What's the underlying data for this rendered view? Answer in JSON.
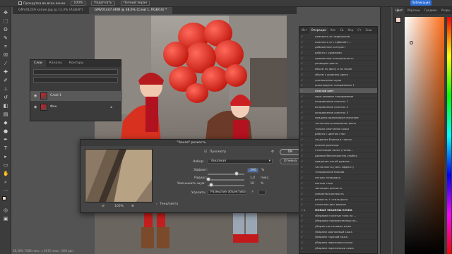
{
  "options_bar": {
    "scroll_all": "Прокрутка во всех окнах",
    "zoom": "100%",
    "fit_screen": "Подогнать",
    "full_screen": "Полный экран",
    "publish": "Публикация"
  },
  "doc_tabs": [
    {
      "label": "GMV01249 копия.jpg @ 13,3% (RGB/8*)",
      "active": false
    },
    {
      "label": "GMV01447.ARW @ 38,6% (Слой 1, RGB/16) *",
      "active": true
    }
  ],
  "status_bar": {
    "zoom": "38,58%",
    "info": "7008 пикс. x 4672 пикс. (300 ppi)"
  },
  "layers_panel": {
    "tabs": [
      "Слои",
      "Каналы",
      "Контуры"
    ],
    "layers": [
      {
        "name": "Слой 1",
        "selected": true
      },
      {
        "name": "Фон",
        "selected": false
      }
    ]
  },
  "smart_sharpen": {
    "title": "\"Умная\" резкость",
    "preview_label": "Просмотр",
    "ok": "ОК",
    "cancel": "Отмена",
    "preset_label": "Набор:",
    "preset_value": "Заказная",
    "amount_label": "Эффект:",
    "amount_value": "390",
    "amount_unit": "%",
    "amount_fraction": 0.78,
    "radius_label": "Радиус:",
    "radius_value": "1,0",
    "radius_unit": "пикс.",
    "radius_fraction": 0.02,
    "noise_label": "Уменьшить шум:",
    "noise_value": "10",
    "noise_unit": "%",
    "noise_fraction": 0.1,
    "remove_label": "Удалить:",
    "remove_value": "Размытие объектива",
    "zoom_value": "100%",
    "shadows_label": "Тени/света"
  },
  "history_panel": {
    "tabs": [
      "Ист",
      "Операции",
      "Кис",
      "Св",
      "Кор",
      "Ст",
      "Экш"
    ],
    "items": [
      {
        "label": "изменить от терракотов",
        "type": "item"
      },
      {
        "label": "изменить от глубокой т...",
        "type": "item"
      },
      {
        "label": "добавление контраст",
        "type": "item"
      },
      {
        "label": "работа с уровнями",
        "type": "item"
      },
      {
        "label": "правильное насыщенность",
        "type": "item"
      },
      {
        "label": "разводим цвета",
        "type": "item"
      },
      {
        "label": "объем по фону и на герое",
        "type": "item"
      },
      {
        "label": "объем с уровнем цвета",
        "type": "item"
      },
      {
        "label": "уменьшение шума",
        "type": "item"
      },
      {
        "label": "шоколадное тонирование 1",
        "type": "item"
      },
      {
        "label": "нежный цвет",
        "type": "selected"
      },
      {
        "label": "серо-лиловое тонирование",
        "type": "item"
      },
      {
        "label": "исправление синеток 1",
        "type": "item"
      },
      {
        "label": "исправление синеток 2",
        "type": "item"
      },
      {
        "label": "исправление синеток 3",
        "type": "item"
      },
      {
        "label": "придаем оранжевым свечение",
        "type": "item"
      },
      {
        "label": "частичное размывание фона",
        "type": "item"
      },
      {
        "label": "тонкая смягчение кожи",
        "type": "item"
      },
      {
        "label": "работа с цветом глаз",
        "type": "item"
      },
      {
        "label": "создание бликов в глазах",
        "type": "item"
      },
      {
        "label": "красим румянцы",
        "type": "item"
      },
      {
        "label": "стилизация волос (тонир...",
        "type": "item"
      },
      {
        "label": "дамаем безопложную улыбку",
        "type": "item"
      },
      {
        "label": "придание пятой румяне...",
        "type": "item"
      },
      {
        "label": "частичность (чекс эффект)",
        "type": "item"
      },
      {
        "label": "тонирование бликов",
        "type": "item"
      },
      {
        "label": "легкая тонировка",
        "type": "item"
      },
      {
        "label": "мягкие тени",
        "type": "item"
      },
      {
        "label": "звенящая резкость",
        "type": "item"
      },
      {
        "label": "умеренная резкость",
        "type": "item"
      },
      {
        "label": "резкость + стиль фото",
        "type": "item"
      },
      {
        "label": "сложные цвет веркие",
        "type": "item"
      },
      {
        "label": "НОВЫЕ ЭКШЕНЫ КОЖА",
        "type": "set"
      },
      {
        "label": "уберааем грязные тона на ...",
        "type": "item"
      },
      {
        "label": "уберааем пересвеченную по...",
        "type": "item"
      },
      {
        "label": "уберем синтоновые кожа",
        "type": "item"
      },
      {
        "label": "убираем оранжевый кожа",
        "type": "item"
      },
      {
        "label": "убираем горячий кожа",
        "type": "item"
      },
      {
        "label": "убираем переналоги кожа",
        "type": "item"
      },
      {
        "label": "убираем переналожи кожа",
        "type": "item"
      }
    ]
  },
  "color_panel": {
    "tabs": [
      "Цвет",
      "Образцы",
      "Градиен",
      "Узоры"
    ]
  },
  "colors": {
    "foreground": "#f3d9c9",
    "background": "#ffffff",
    "picker_hue": "#ff6f1a"
  }
}
